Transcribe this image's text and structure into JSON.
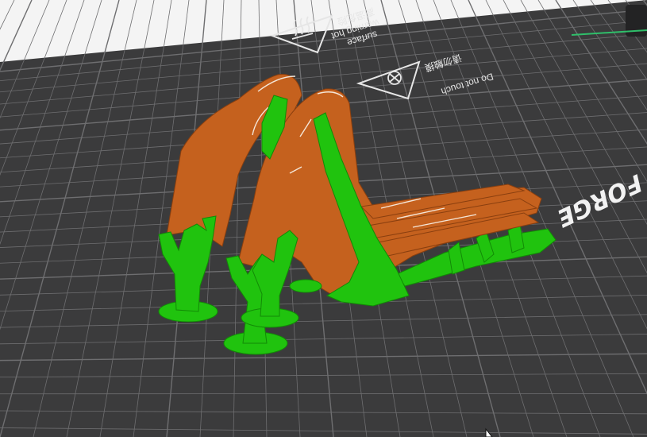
{
  "viewport": {
    "background": "#f4f4f4",
    "bed_color": "#3b3b3c",
    "grid_color": "#6e6e70",
    "accent_strip_color": "#2fbf6a"
  },
  "bed": {
    "warning_hot_en": "warning hot",
    "warning_hot_cn": "高温危险",
    "warning_hot_surface": "surface",
    "do_not_touch_en": "Do not touch",
    "do_not_touch_cn": "请勿触摸",
    "brand_text": "FORGE",
    "hot_icon": "hot-surface-icon",
    "touch_icon": "no-touch-icon"
  },
  "model": {
    "part_color": "#c5611e",
    "support_color": "#20c30e"
  },
  "cursor": {
    "icon": "mouse-cursor-icon"
  }
}
